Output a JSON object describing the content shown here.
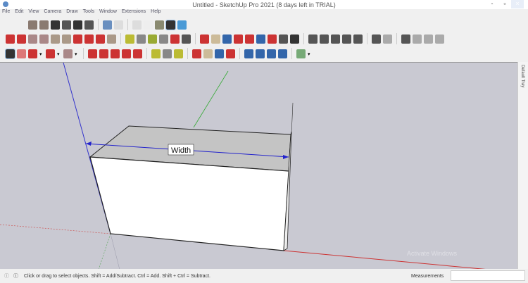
{
  "window": {
    "title": "Untitled - SketchUp Pro 2021 (8 days left in TRIAL)",
    "minimize": "-",
    "maximize": "▫",
    "close": "×"
  },
  "menu": [
    "File",
    "Edit",
    "View",
    "Camera",
    "Draw",
    "Tools",
    "Window",
    "Extensions",
    "Help"
  ],
  "toolbars": {
    "row1": [
      [
        "iso-view",
        "#8a7a70"
      ],
      [
        "top-view",
        "#8a7a70"
      ],
      [
        "front-view",
        "#333"
      ],
      [
        "right-view",
        "#555"
      ],
      [
        "back-view",
        "#333"
      ],
      [
        "left-view",
        "#555"
      ],
      [
        "|",
        ""
      ],
      [
        "xray",
        "#6a8fbf"
      ],
      [
        "wireframe",
        "#ddd"
      ],
      [
        "|",
        ""
      ],
      [
        "hidden-line",
        "#ddd"
      ],
      [
        "shaded",
        "#eee"
      ],
      [
        "shaded-textures",
        "#8a8a70"
      ],
      [
        "monochrome",
        "#333"
      ],
      [
        "shaded-blue",
        "#4a9ad6"
      ]
    ],
    "row2": [
      [
        "pencil",
        "#c33"
      ],
      [
        "freehand",
        "#c33"
      ],
      [
        "rectangle",
        "#a88"
      ],
      [
        "rotated-rectangle",
        "#a88"
      ],
      [
        "circle",
        "#a98"
      ],
      [
        "polygon",
        "#a98"
      ],
      [
        "arc",
        "#c33"
      ],
      [
        "2pt-arc",
        "#c33"
      ],
      [
        "3pt-arc",
        "#c33"
      ],
      [
        "pie",
        "#a98"
      ],
      [
        "|",
        ""
      ],
      [
        "tape-measure",
        "#bb3"
      ],
      [
        "dimension",
        "#888"
      ],
      [
        "protractor",
        "#9a3"
      ],
      [
        "text",
        "#888"
      ],
      [
        "axes",
        "#c33"
      ],
      [
        "3d-text",
        "#555"
      ],
      [
        "|",
        ""
      ],
      [
        "orbit",
        "#c33"
      ],
      [
        "pan",
        "#cb9"
      ],
      [
        "zoom",
        "#36a"
      ],
      [
        "zoom-window",
        "#c33"
      ],
      [
        "zoom-extents",
        "#c33"
      ],
      [
        "position-camera",
        "#36a"
      ],
      [
        "walk",
        "#c33"
      ],
      [
        "look-around",
        "#555"
      ],
      [
        "footprints",
        "#333"
      ],
      [
        "|",
        ""
      ],
      [
        "model-info",
        "#555"
      ],
      [
        "warehouse",
        "#555"
      ],
      [
        "extension-warehouse",
        "#555"
      ],
      [
        "trimble-connect",
        "#555"
      ],
      [
        "sync",
        "#555"
      ],
      [
        "|",
        ""
      ],
      [
        "generate-report",
        "#555"
      ],
      [
        "report2",
        "#aaa"
      ],
      [
        "|",
        ""
      ],
      [
        "scenes",
        "#555"
      ],
      [
        "layout1",
        "#aaa"
      ],
      [
        "layout2",
        "#aaa"
      ],
      [
        "lock",
        "#aaa"
      ]
    ],
    "row3": [
      [
        "select",
        "#333"
      ],
      [
        "eraser",
        "#d77"
      ],
      [
        "line",
        "#c33"
      ],
      [
        "dd1",
        "#333"
      ],
      [
        "arc-tool",
        "#c33"
      ],
      [
        "dd2",
        "#333"
      ],
      [
        "shape",
        "#a88"
      ],
      [
        "dd3",
        "#333"
      ],
      [
        "|",
        ""
      ],
      [
        "push-pull",
        "#c33"
      ],
      [
        "follow-me",
        "#c33"
      ],
      [
        "move",
        "#c33"
      ],
      [
        "rotate",
        "#c33"
      ],
      [
        "scale",
        "#c33"
      ],
      [
        "|",
        ""
      ],
      [
        "tape",
        "#bb3"
      ],
      [
        "text-tool",
        "#888"
      ],
      [
        "paint-bucket",
        "#bb3"
      ],
      [
        "|",
        ""
      ],
      [
        "orbit",
        "#c33"
      ],
      [
        "pan",
        "#cb9"
      ],
      [
        "zoom",
        "#36a"
      ],
      [
        "zoom-extents",
        "#c33"
      ],
      [
        "|",
        ""
      ],
      [
        "outliner",
        "#36a"
      ],
      [
        "components",
        "#36a"
      ],
      [
        "styles",
        "#36a"
      ],
      [
        "tags",
        "#36a"
      ],
      [
        "|",
        ""
      ],
      [
        "account",
        "#7a7"
      ],
      [
        "dd4",
        "#333"
      ]
    ]
  },
  "viewport": {
    "dimension_label": "Width",
    "watermark": "Activate Windows"
  },
  "tray": {
    "label": "Default Tray"
  },
  "status": {
    "hint": "Click or drag to select objects. Shift = Add/Subtract. Ctrl = Add. Shift + Ctrl = Subtract.",
    "measurements_label": "Measurements",
    "measurements_value": ""
  }
}
